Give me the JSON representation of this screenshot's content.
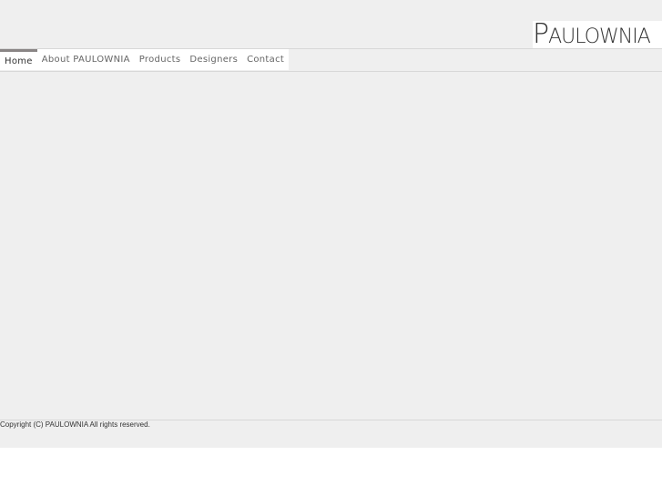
{
  "brand": {
    "logo_text": "PAULOWNIA"
  },
  "nav": {
    "items": [
      {
        "label": "Home"
      },
      {
        "label": "About PAULOWNIA"
      },
      {
        "label": "Products"
      },
      {
        "label": "Designers"
      },
      {
        "label": "Contact"
      }
    ]
  },
  "footer": {
    "copyright": "Copyright (C) PAULOWNIA All rights reserved."
  }
}
